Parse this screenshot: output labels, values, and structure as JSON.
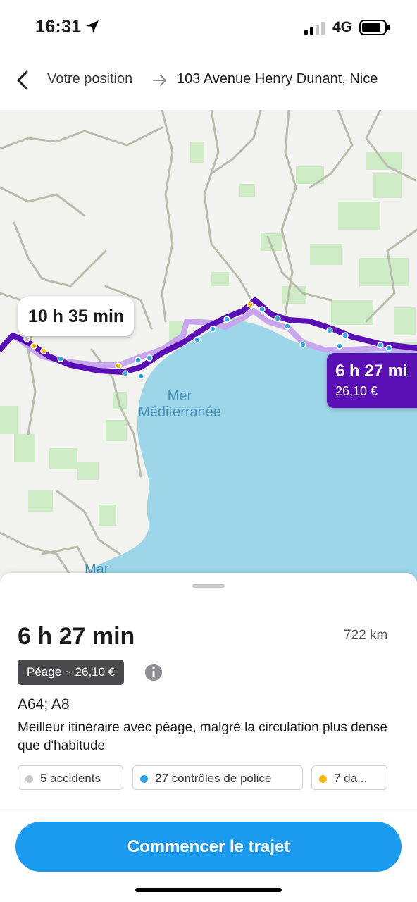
{
  "status_bar": {
    "time": "16:31",
    "network": "4G"
  },
  "header": {
    "origin": "Votre position",
    "destination": "103 Avenue Henry Dunant, Nice"
  },
  "map": {
    "alt_route_label": "10 h 35 min",
    "main_route": {
      "time": "6 h 27 mi",
      "price": "26,10 €"
    },
    "sea_label_line1": "Mer",
    "sea_label_line2": "Méditerranée",
    "sea_label_cut": "Mar"
  },
  "route": {
    "duration": "6 h 27 min",
    "distance": "722 km",
    "toll_badge": "Péage ~ 26,10 €",
    "roads": "A64; A8",
    "description": "Meilleur itinéraire avec péage, malgré la circulation plus dense que d'habitude",
    "chips": [
      {
        "label": "5 accidents",
        "dot_color": "#c7c7cc"
      },
      {
        "label": "27 contrôles de police",
        "dot_color": "#2ea6e8"
      },
      {
        "label": "7 da...",
        "dot_color": "#f5b800"
      }
    ]
  },
  "actions": {
    "start": "Commencer le trajet"
  },
  "colors": {
    "route_main": "#5a0fb5",
    "route_alt": "#c7a6ee",
    "sea": "#9dd6e8",
    "accent": "#1a9bf0"
  }
}
